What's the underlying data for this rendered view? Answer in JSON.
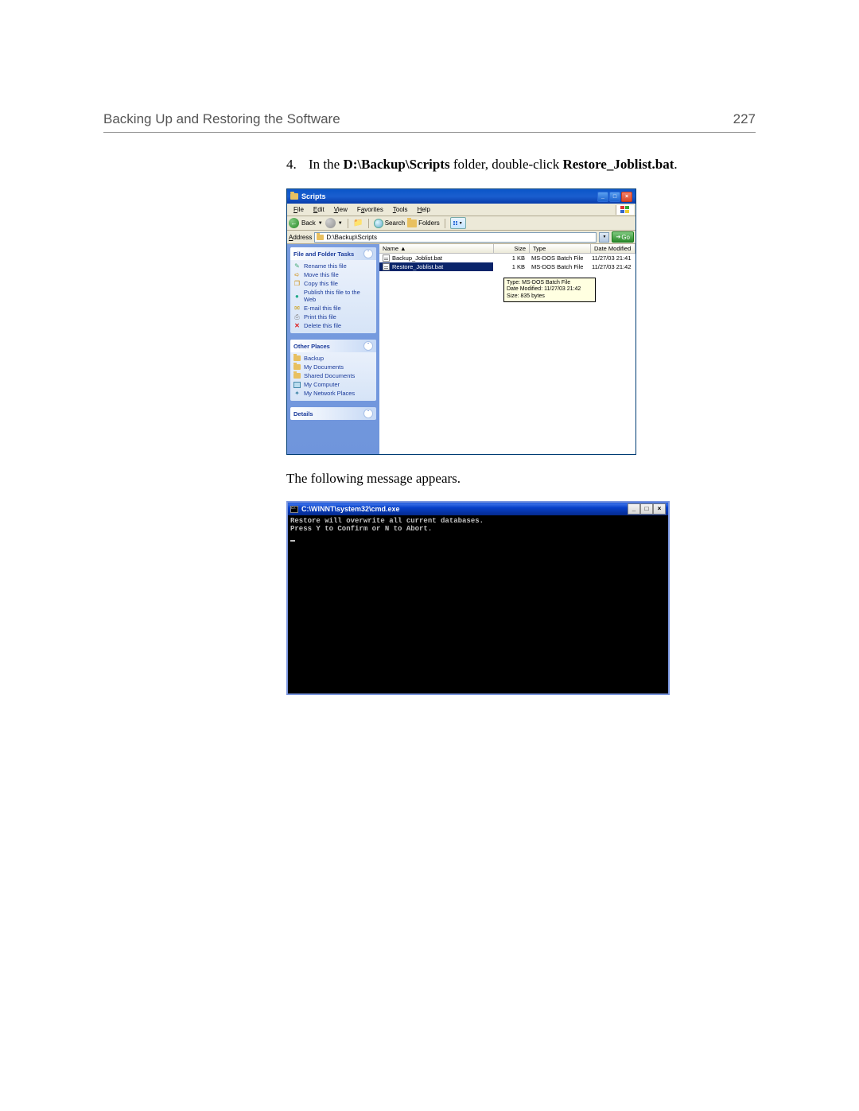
{
  "header": {
    "title": "Backing Up and Restoring the Software",
    "page_num": "227"
  },
  "step": {
    "num": "4.",
    "prefix": "In the ",
    "folder": "D:\\Backup\\Scripts",
    "mid": " folder, double-click ",
    "file": "Restore_Joblist.bat",
    "suffix": "."
  },
  "explorer": {
    "title": "Scripts",
    "menus": {
      "file": "File",
      "edit": "Edit",
      "view": "View",
      "favorites": "Favorites",
      "tools": "Tools",
      "help": "Help"
    },
    "toolbar": {
      "back": "Back",
      "search": "Search",
      "folders": "Folders"
    },
    "address": {
      "label": "Address",
      "path": "D:\\Backup\\Scripts",
      "go": "Go"
    },
    "columns": {
      "name": "Name ▲",
      "size": "Size",
      "type": "Type",
      "date": "Date Modified"
    },
    "files": [
      {
        "name": "Backup_Joblist.bat",
        "size": "1 KB",
        "type": "MS-DOS Batch File",
        "date": "11/27/03 21:41",
        "selected": false
      },
      {
        "name": "Restore_Joblist.bat",
        "size": "1 KB",
        "type": "MS-DOS Batch File",
        "date": "11/27/03 21:42",
        "selected": true
      }
    ],
    "sidebar": {
      "tasks_hdr": "File and Folder Tasks",
      "tasks": {
        "rename": "Rename this file",
        "move": "Move this file",
        "copy": "Copy this file",
        "publish": "Publish this file to the Web",
        "email": "E-mail this file",
        "print": "Print this file",
        "delete": "Delete this file"
      },
      "other_hdr": "Other Places",
      "other": {
        "backup": "Backup",
        "mydocs": "My Documents",
        "shared": "Shared Documents",
        "mycomputer": "My Computer",
        "network": "My Network Places"
      },
      "details_hdr": "Details"
    },
    "tooltip": {
      "line1": "Type: MS-DOS Batch File",
      "line2": "Date Modified: 11/27/03 21:42",
      "line3": "Size: 835 bytes"
    }
  },
  "body_text": "The following message appears.",
  "cmd": {
    "title": "C:\\WINNT\\system32\\cmd.exe",
    "line1": "Restore will overwrite all current databases.",
    "line2": "Press Y to Confirm or N to Abort."
  }
}
